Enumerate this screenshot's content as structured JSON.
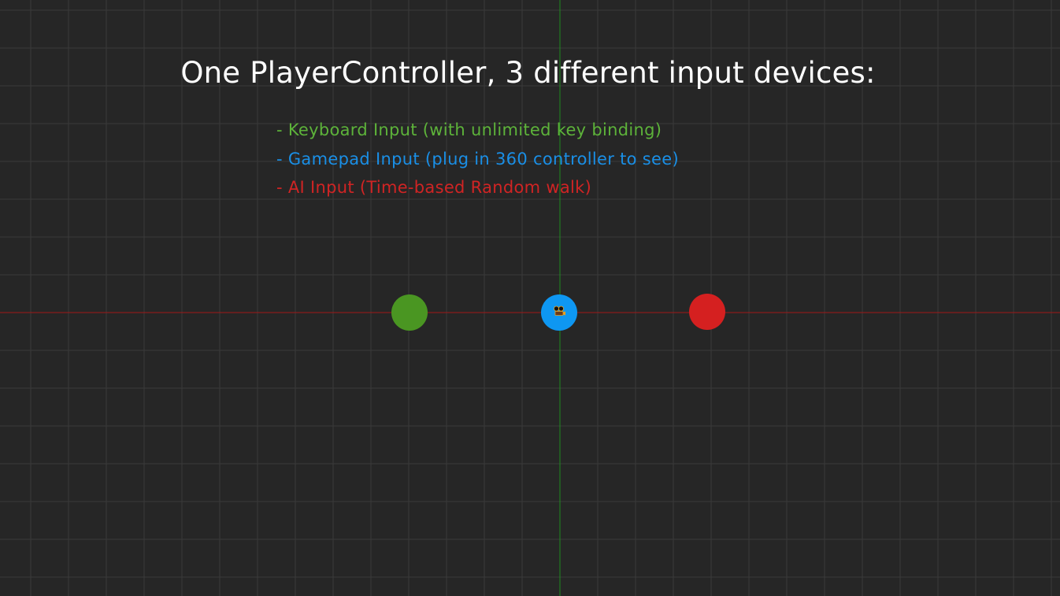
{
  "scene": {
    "title": "One PlayerController, 3 different input devices:",
    "background_color": "#262626",
    "grid_color": "#3a3a3a",
    "axis_x_color": "#a01818",
    "axis_y_color": "#1f8a1f"
  },
  "devices": [
    {
      "label": "- Keyboard Input (with unlimited key binding)",
      "color": "#5db33a"
    },
    {
      "label": "- Gamepad Input (plug in 360 controller to see)",
      "color": "#1a8fe6"
    },
    {
      "label": "- AI Input (Time-based Random walk)",
      "color": "#d02424"
    }
  ],
  "players": [
    {
      "input": "keyboard",
      "color": "#4a9622"
    },
    {
      "input": "gamepad",
      "color": "#0e97f2"
    },
    {
      "input": "ai",
      "color": "#d52020"
    }
  ],
  "icons": {
    "camera": "camera-icon"
  }
}
